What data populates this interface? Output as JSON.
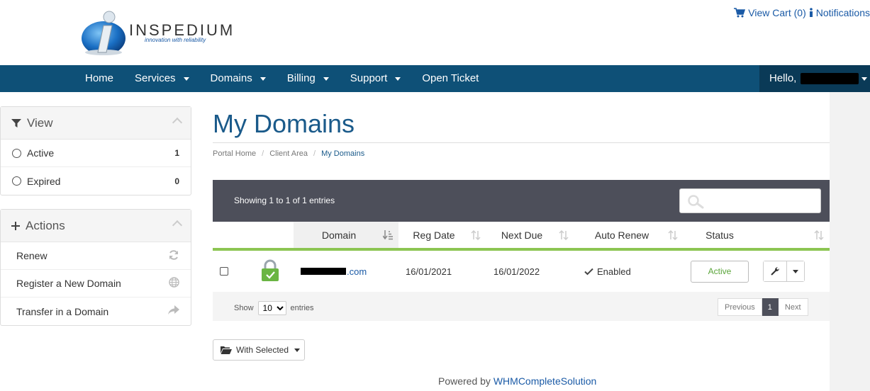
{
  "brand": {
    "name": "INSPEDIUM",
    "tagline": "innovation with reliability"
  },
  "top_links": {
    "cart_label": "View Cart (0)",
    "notifications_label": "Notifications"
  },
  "nav": {
    "items": [
      {
        "label": "Home",
        "dropdown": false
      },
      {
        "label": "Services",
        "dropdown": true
      },
      {
        "label": "Domains",
        "dropdown": true
      },
      {
        "label": "Billing",
        "dropdown": true
      },
      {
        "label": "Support",
        "dropdown": true
      },
      {
        "label": "Open Ticket",
        "dropdown": false
      }
    ],
    "greeting": "Hello,"
  },
  "sidebar": {
    "view": {
      "title": "View",
      "items": [
        {
          "label": "Active",
          "count": "1"
        },
        {
          "label": "Expired",
          "count": "0"
        }
      ]
    },
    "actions": {
      "title": "Actions",
      "items": [
        {
          "label": "Renew",
          "icon": "refresh-icon"
        },
        {
          "label": "Register a New Domain",
          "icon": "globe-icon"
        },
        {
          "label": "Transfer in a Domain",
          "icon": "share-arrow-icon"
        }
      ]
    }
  },
  "main": {
    "title": "My Domains",
    "breadcrumb": [
      "Portal Home",
      "Client Area",
      "My Domains"
    ],
    "showing": "Showing 1 to 1 of 1 entries",
    "search_placeholder": "",
    "columns": [
      "Domain",
      "Reg Date",
      "Next Due",
      "Auto Renew",
      "Status"
    ],
    "rows": [
      {
        "domain_suffix": ".com",
        "reg_date": "16/01/2021",
        "next_due": "16/01/2022",
        "auto_renew": "Enabled",
        "status": "Active"
      }
    ],
    "length": {
      "prefix": "Show",
      "value": "10",
      "suffix": "entries"
    },
    "pagination": {
      "previous": "Previous",
      "current": "1",
      "next": "Next"
    },
    "with_selected": "With Selected"
  },
  "footer": {
    "prefix": "Powered by",
    "link": "WHMCompleteSolution"
  },
  "colors": {
    "navbar": "#0e5077",
    "accent_green": "#8cc552",
    "table_header": "#4d4f5a",
    "link": "#1a5aa6"
  }
}
